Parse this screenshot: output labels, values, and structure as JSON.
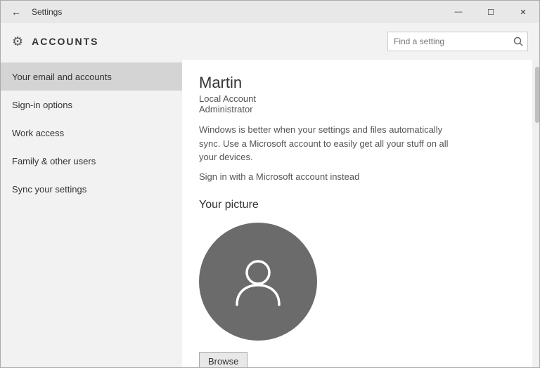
{
  "window": {
    "title": "Settings",
    "controls": {
      "minimize": "—",
      "maximize": "☐",
      "close": "✕"
    }
  },
  "header": {
    "icon": "⚙",
    "title": "ACCOUNTS",
    "search_placeholder": "Find a setting",
    "search_icon": "🔍"
  },
  "sidebar": {
    "items": [
      {
        "id": "email-accounts",
        "label": "Your email and accounts",
        "active": true
      },
      {
        "id": "sign-in-options",
        "label": "Sign-in options",
        "active": false
      },
      {
        "id": "work-access",
        "label": "Work access",
        "active": false
      },
      {
        "id": "family-other-users",
        "label": "Family & other users",
        "active": false
      },
      {
        "id": "sync-settings",
        "label": "Sync your settings",
        "active": false
      }
    ]
  },
  "main": {
    "user": {
      "name": "Martin",
      "account_type": "Local Account",
      "role": "Administrator"
    },
    "sync_message": "Windows is better when your settings and files automatically sync. Use a Microsoft account to easily get all your stuff on all your devices.",
    "sign_in_link": "Sign in with a Microsoft account instead",
    "picture_section": {
      "title": "Your picture",
      "browse_label": "Browse"
    }
  }
}
